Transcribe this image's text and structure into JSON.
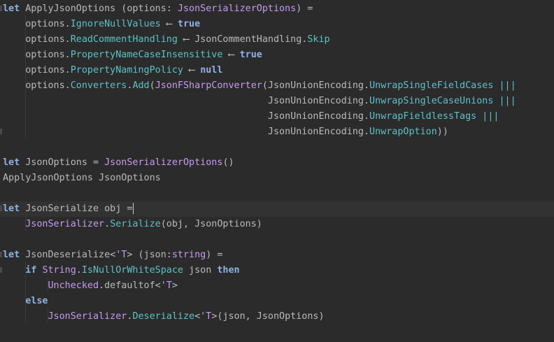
{
  "editor": {
    "language": "F#",
    "lines": [
      [
        {
          "t": "let",
          "c": "kw"
        },
        {
          "t": " ApplyJsonOptions (options: ",
          "c": "plain"
        },
        {
          "t": "JsonSerializerOptions",
          "c": "type"
        },
        {
          "t": ") =",
          "c": "plain"
        }
      ],
      [
        {
          "t": "    options.",
          "c": "plain"
        },
        {
          "t": "IgnoreNullValues",
          "c": "mem"
        },
        {
          "t": " ⟵ ",
          "c": "op"
        },
        {
          "t": "true",
          "c": "kw"
        }
      ],
      [
        {
          "t": "    options.",
          "c": "plain"
        },
        {
          "t": "ReadCommentHandling",
          "c": "mem"
        },
        {
          "t": " ⟵ JsonCommentHandling.",
          "c": "plain"
        },
        {
          "t": "Skip",
          "c": "mem"
        }
      ],
      [
        {
          "t": "    options.",
          "c": "plain"
        },
        {
          "t": "PropertyNameCaseInsensitive",
          "c": "mem"
        },
        {
          "t": " ⟵ ",
          "c": "op"
        },
        {
          "t": "true",
          "c": "kw"
        }
      ],
      [
        {
          "t": "    options.",
          "c": "plain"
        },
        {
          "t": "PropertyNamingPolicy",
          "c": "mem"
        },
        {
          "t": " ⟵ ",
          "c": "op"
        },
        {
          "t": "null",
          "c": "kw"
        }
      ],
      [
        {
          "t": "    options.",
          "c": "plain"
        },
        {
          "t": "Converters",
          "c": "mem"
        },
        {
          "t": ".",
          "c": "plain"
        },
        {
          "t": "Add",
          "c": "mem"
        },
        {
          "t": "(",
          "c": "plain"
        },
        {
          "t": "JsonFSharpConverter",
          "c": "type"
        },
        {
          "t": "(JsonUnionEncoding.",
          "c": "plain"
        },
        {
          "t": "UnwrapSingleFieldCases",
          "c": "mem"
        },
        {
          "t": " |||",
          "c": "mem"
        }
      ],
      [
        {
          "t": "                                               JsonUnionEncoding.",
          "c": "plain"
        },
        {
          "t": "UnwrapSingleCaseUnions",
          "c": "mem"
        },
        {
          "t": " |||",
          "c": "mem"
        }
      ],
      [
        {
          "t": "                                               JsonUnionEncoding.",
          "c": "plain"
        },
        {
          "t": "UnwrapFieldlessTags",
          "c": "mem"
        },
        {
          "t": " |||",
          "c": "mem"
        }
      ],
      [
        {
          "t": "                                               JsonUnionEncoding.",
          "c": "plain"
        },
        {
          "t": "UnwrapOption",
          "c": "mem"
        },
        {
          "t": "))",
          "c": "plain"
        }
      ],
      [],
      [
        {
          "t": "let",
          "c": "kw"
        },
        {
          "t": " JsonOptions = ",
          "c": "plain"
        },
        {
          "t": "JsonSerializerOptions",
          "c": "type"
        },
        {
          "t": "()",
          "c": "plain"
        }
      ],
      [
        {
          "t": "ApplyJsonOptions JsonOptions",
          "c": "plain"
        }
      ],
      [],
      [
        {
          "t": "let",
          "c": "kw"
        },
        {
          "t": " JsonSerialize obj =",
          "c": "plain"
        }
      ],
      [
        {
          "t": "    ",
          "c": "plain"
        },
        {
          "t": "JsonSerializer",
          "c": "type"
        },
        {
          "t": ".",
          "c": "plain"
        },
        {
          "t": "Serialize",
          "c": "mem"
        },
        {
          "t": "(obj, JsonOptions)",
          "c": "plain"
        }
      ],
      [],
      [
        {
          "t": "let",
          "c": "kw"
        },
        {
          "t": " JsonDeserialize<'",
          "c": "plain"
        },
        {
          "t": "T",
          "c": "type"
        },
        {
          "t": "> (json:",
          "c": "plain"
        },
        {
          "t": "string",
          "c": "type"
        },
        {
          "t": ") =",
          "c": "plain"
        }
      ],
      [
        {
          "t": "    ",
          "c": "plain"
        },
        {
          "t": "if",
          "c": "kw"
        },
        {
          "t": " ",
          "c": "plain"
        },
        {
          "t": "String",
          "c": "type"
        },
        {
          "t": ".",
          "c": "plain"
        },
        {
          "t": "IsNullOrWhiteSpace",
          "c": "mem"
        },
        {
          "t": " json ",
          "c": "plain"
        },
        {
          "t": "then",
          "c": "kw"
        }
      ],
      [
        {
          "t": "        ",
          "c": "plain"
        },
        {
          "t": "Unchecked",
          "c": "type"
        },
        {
          "t": ".defaultof<'",
          "c": "plain"
        },
        {
          "t": "T",
          "c": "type"
        },
        {
          "t": ">",
          "c": "plain"
        }
      ],
      [
        {
          "t": "    ",
          "c": "plain"
        },
        {
          "t": "else",
          "c": "kw"
        }
      ],
      [
        {
          "t": "        ",
          "c": "plain"
        },
        {
          "t": "JsonSerializer",
          "c": "type"
        },
        {
          "t": ".",
          "c": "plain"
        },
        {
          "t": "Deserialize",
          "c": "mem"
        },
        {
          "t": "<'",
          "c": "plain"
        },
        {
          "t": "T",
          "c": "type"
        },
        {
          "t": ">(json, JsonOptions)",
          "c": "plain"
        }
      ]
    ]
  }
}
